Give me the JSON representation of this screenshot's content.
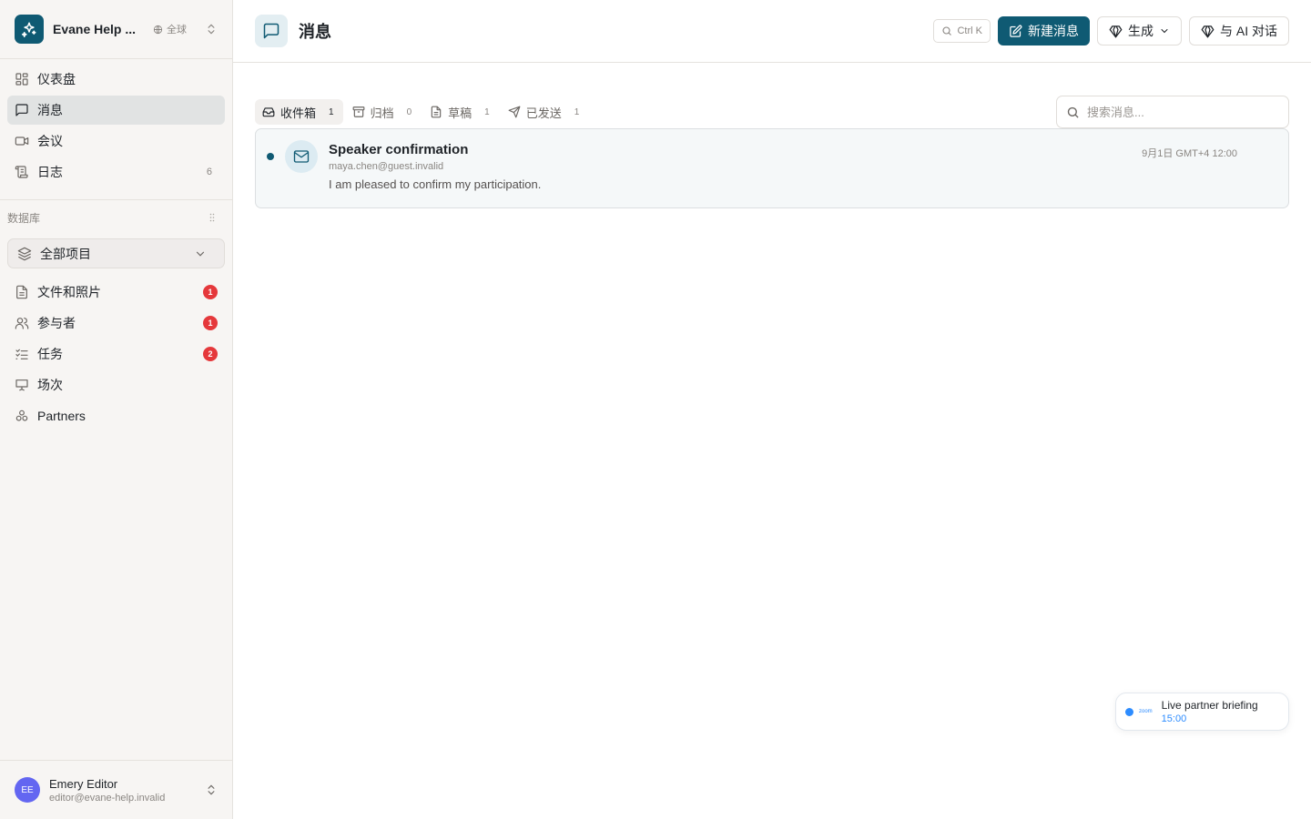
{
  "workspace": {
    "name": "Evane Help ...",
    "scope": "全球"
  },
  "nav": {
    "dashboard": "仪表盘",
    "messages": "消息",
    "meetings": "会议",
    "logs": "日志",
    "logs_count": "6"
  },
  "database": {
    "title": "数据库",
    "selector": "全部项目",
    "items": [
      {
        "label": "文件和照片",
        "badge": "1"
      },
      {
        "label": "参与者",
        "badge": "1"
      },
      {
        "label": "任务",
        "badge": "2"
      },
      {
        "label": "场次"
      },
      {
        "label": "Partners"
      }
    ]
  },
  "user": {
    "initials": "EE",
    "name": "Emery Editor",
    "email": "editor@evane-help.invalid"
  },
  "header": {
    "title": "消息",
    "shortcut": "Ctrl K",
    "new_message": "新建消息",
    "generate": "生成",
    "ai_chat": "与 AI 对话"
  },
  "tabs": [
    {
      "label": "收件箱",
      "count": "1"
    },
    {
      "label": "归档",
      "count": "0"
    },
    {
      "label": "草稿",
      "count": "1"
    },
    {
      "label": "已发送",
      "count": "1"
    }
  ],
  "search": {
    "placeholder": "搜索消息..."
  },
  "messages": [
    {
      "subject": "Speaker confirmation",
      "from": "maya.chen@guest.invalid",
      "preview": "I am pleased to confirm my participation.",
      "date": "9月1日 GMT+4 12:00"
    }
  ],
  "live": {
    "tag": "zoom",
    "title": "Live partner briefing",
    "time": "15:00"
  },
  "colors": {
    "primary": "#0f5a73",
    "badge": "#e5383b",
    "live": "#2d8cff",
    "avatar": "#6366f1"
  }
}
